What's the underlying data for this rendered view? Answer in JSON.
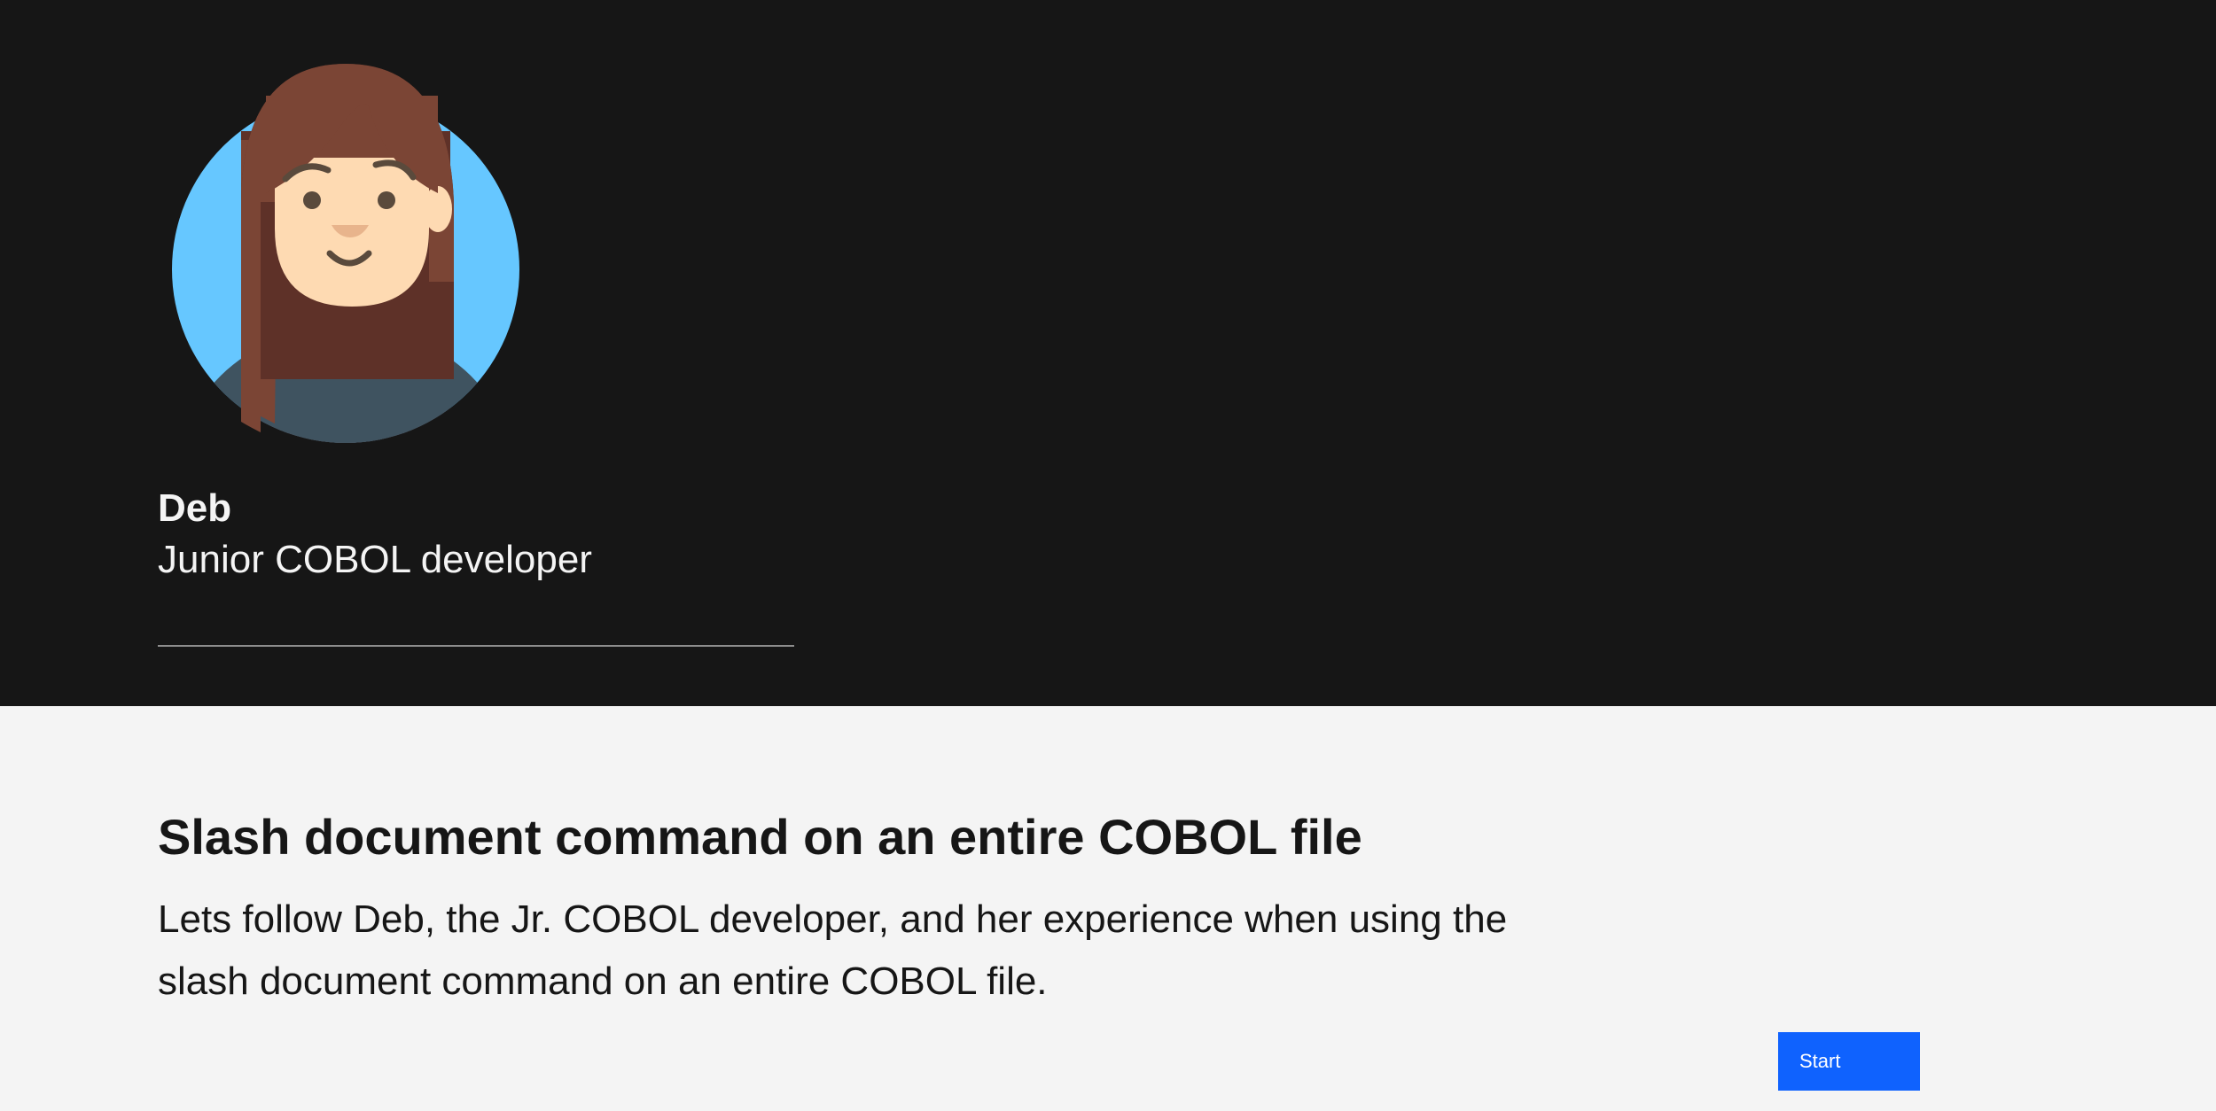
{
  "persona": {
    "name": "Deb",
    "role": "Junior COBOL developer",
    "avatar_icon": "woman-avatar-icon"
  },
  "scenario": {
    "title": "Slash document command on an entire COBOL file",
    "description": "Lets follow Deb, the Jr. COBOL developer, and her experience when using the slash document command on an entire COBOL file."
  },
  "actions": {
    "start_label": "Start"
  },
  "colors": {
    "hero_background": "#161616",
    "content_background": "#f4f4f4",
    "primary_button": "#0f62fe",
    "avatar_circle": "#66c7ff",
    "hair": "#7b4535",
    "skin": "#fedab2",
    "sweater": "#3f5360"
  }
}
